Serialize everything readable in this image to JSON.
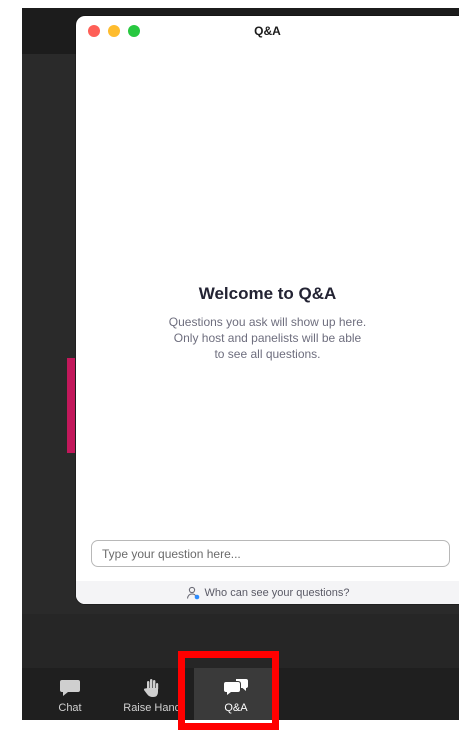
{
  "window": {
    "title": "Q&A"
  },
  "welcome": {
    "title": "Welcome to Q&A",
    "message": "Questions you ask will show up here. Only host and panelists will be able to see all questions."
  },
  "question_input": {
    "placeholder": "Type your question here..."
  },
  "footer": {
    "who_can_see_label": "Who can see your questions?"
  },
  "toolbar": {
    "items": [
      {
        "label": "Chat",
        "icon": "chat-bubble-icon"
      },
      {
        "label": "Raise Hand",
        "icon": "raise-hand-icon"
      },
      {
        "label": "Q&A",
        "icon": "qa-bubbles-icon",
        "active": true
      }
    ]
  },
  "colors": {
    "highlight": "#ff0000",
    "speaker_accent": "#c2185b",
    "close": "#fe5f57",
    "minimize": "#febc2e",
    "maximize": "#28c840"
  }
}
